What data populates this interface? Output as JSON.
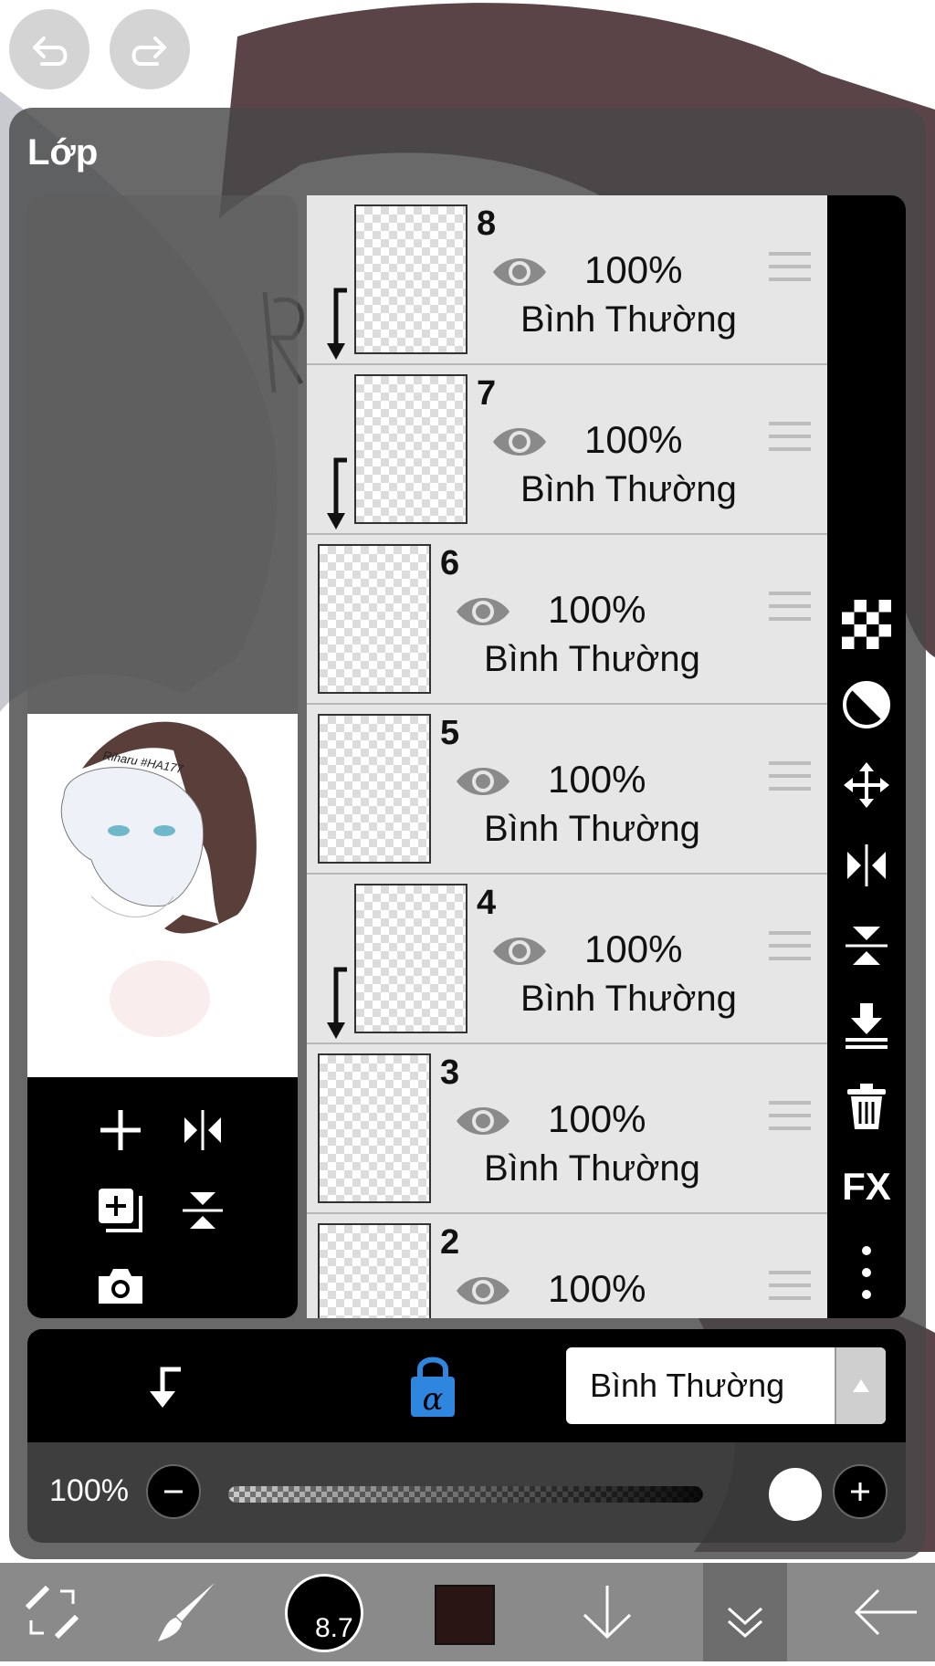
{
  "panel": {
    "title": "Lớp"
  },
  "layers": [
    {
      "number": "8",
      "opacity": "100%",
      "blend": "Bình Thường",
      "clipped": true
    },
    {
      "number": "7",
      "opacity": "100%",
      "blend": "Bình Thường",
      "clipped": true
    },
    {
      "number": "6",
      "opacity": "100%",
      "blend": "Bình Thường",
      "clipped": false
    },
    {
      "number": "5",
      "opacity": "100%",
      "blend": "Bình Thường",
      "clipped": false
    },
    {
      "number": "4",
      "opacity": "100%",
      "blend": "Bình Thường",
      "clipped": true
    },
    {
      "number": "3",
      "opacity": "100%",
      "blend": "Bình Thường",
      "clipped": false
    },
    {
      "number": "2",
      "opacity": "100%",
      "blend": "Bình Thường",
      "clipped": false
    }
  ],
  "side_tools": [
    "transparency-icon",
    "invert-icon",
    "move-icon",
    "flip-horizontal-icon",
    "flip-vertical-icon",
    "merge-down-icon",
    "trash-icon",
    "fx-icon",
    "more-icon"
  ],
  "side_tools_fx_label": "FX",
  "preview_tools": [
    "add-layer-icon",
    "flip-horizontal-icon",
    "duplicate-layer-icon",
    "flip-vertical-icon",
    "camera-icon"
  ],
  "blend_bar": {
    "blend_mode": "Bình Thường",
    "alpha_lock_color": "#2e86de"
  },
  "opacity_bar": {
    "label": "100%",
    "value_fraction": 1.0
  },
  "bottom_toolbar": {
    "brush_size": "8.7",
    "primary_color": "#2a1515"
  },
  "thumbnail_signature": "Riharu #HA177"
}
